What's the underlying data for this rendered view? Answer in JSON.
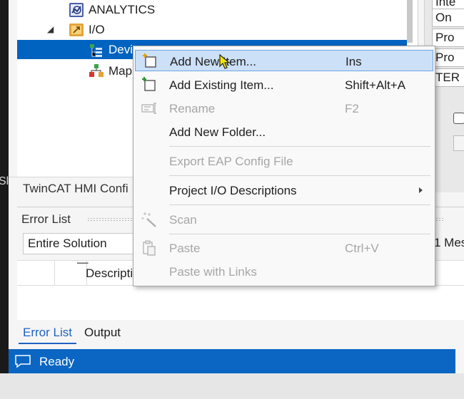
{
  "solution_explorer": {
    "items": [
      {
        "label": "ANALYTICS",
        "icon": "analytics-icon",
        "expanded": null
      },
      {
        "label": "I/O",
        "icon": "io-folder-icon",
        "expanded": true
      },
      {
        "label": "Devi",
        "icon": "devices-icon",
        "selected": true
      },
      {
        "label": "Map",
        "icon": "mappings-icon"
      }
    ]
  },
  "hmi_tab": {
    "label": "TwinCAT HMI Confi"
  },
  "properties_panel": {
    "cells": [
      "Inte",
      "On",
      "Pro",
      "Pro",
      "TER"
    ]
  },
  "left_fragment": "Sl",
  "error_list": {
    "title": "Error List",
    "scope": "Entire Solution",
    "messages_fragment": "1 Mes",
    "columns": [
      "Descriptio"
    ],
    "tabs": [
      {
        "label": "Error List",
        "active": true
      },
      {
        "label": "Output",
        "active": false
      }
    ]
  },
  "status_bar": {
    "text": "Ready"
  },
  "context_menu": {
    "items": [
      {
        "label": "Add New Item...",
        "shortcut": "Ins",
        "enabled": true,
        "highlighted": true,
        "icon": "add-new-item-icon"
      },
      {
        "label": "Add Existing Item...",
        "shortcut": "Shift+Alt+A",
        "enabled": true,
        "icon": "add-existing-item-icon"
      },
      {
        "label": "Rename",
        "shortcut": "F2",
        "enabled": false,
        "icon": "rename-icon"
      },
      {
        "label": "Add New Folder...",
        "shortcut": "",
        "enabled": true
      },
      {
        "label": "Export EAP Config File",
        "shortcut": "",
        "enabled": false
      },
      {
        "label": "Project I/O Descriptions",
        "shortcut": "",
        "enabled": true,
        "submenu": true
      },
      {
        "label": "Scan",
        "shortcut": "",
        "enabled": false,
        "icon": "scan-wand-icon"
      },
      {
        "label": "Paste",
        "shortcut": "Ctrl+V",
        "enabled": false,
        "icon": "paste-icon"
      },
      {
        "label": "Paste with Links",
        "shortcut": "",
        "enabled": false
      }
    ]
  },
  "colors": {
    "selection": "#0063c0",
    "status_bar": "#0a66c2",
    "menu_highlight": "#cce0f7",
    "disabled_text": "#a6a6a6"
  }
}
